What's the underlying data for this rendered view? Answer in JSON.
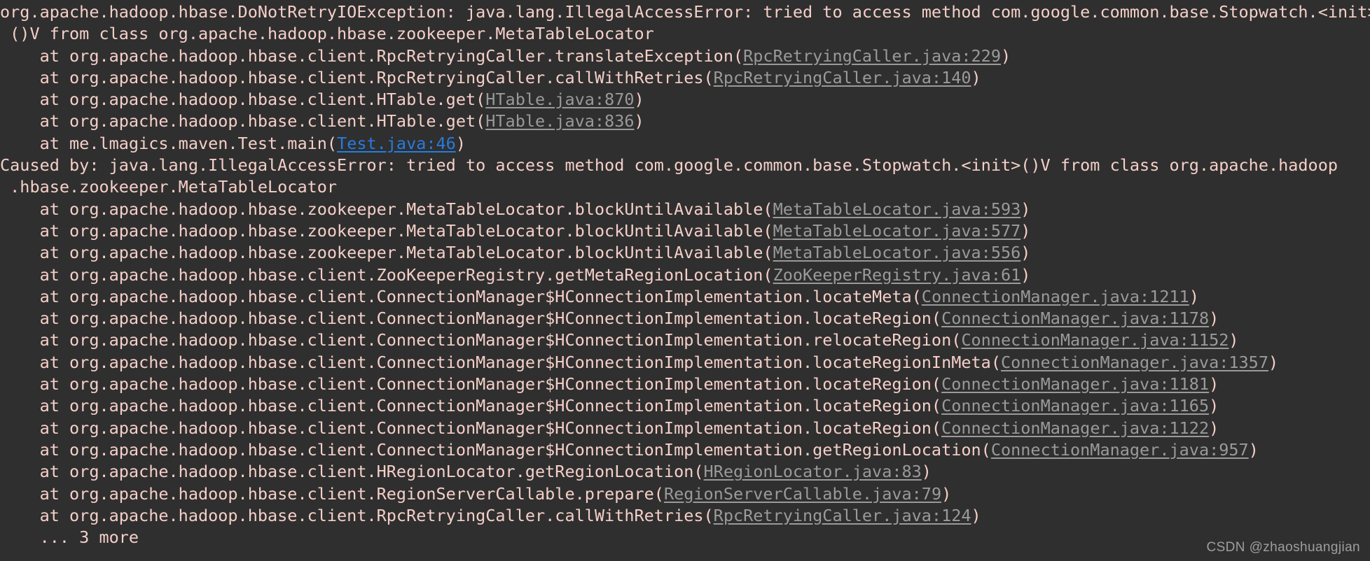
{
  "console": {
    "background_color": "#2f2f2f",
    "text_color": "#f5cfc8",
    "link_color": "#9a9a9a",
    "active_link_color": "#287bde",
    "watermark": "CSDN @zhaoshuangjian"
  },
  "stack_trace": {
    "lines": [
      {
        "id": "exception-header-1",
        "kind": "exception-header",
        "text": "org.apache.hadoop.hbase.DoNotRetryIOException: java.lang.IllegalAccessError: tried to access method com.google.common.base.Stopwatch.<init>"
      },
      {
        "id": "exception-header-2",
        "kind": "exception-header-cont",
        "text": " ()V from class org.apache.hadoop.hbase.zookeeper.MetaTableLocator"
      },
      {
        "id": "frame-1",
        "kind": "frame",
        "prefix": "    at org.apache.hadoop.hbase.client.RpcRetryingCaller.translateException(",
        "link": "RpcRetryingCaller.java:229",
        "link_state": "normal",
        "suffix": ")"
      },
      {
        "id": "frame-2",
        "kind": "frame",
        "prefix": "    at org.apache.hadoop.hbase.client.RpcRetryingCaller.callWithRetries(",
        "link": "RpcRetryingCaller.java:140",
        "link_state": "normal",
        "suffix": ")"
      },
      {
        "id": "frame-3",
        "kind": "frame",
        "prefix": "    at org.apache.hadoop.hbase.client.HTable.get(",
        "link": "HTable.java:870",
        "link_state": "normal",
        "suffix": ")"
      },
      {
        "id": "frame-4",
        "kind": "frame",
        "prefix": "    at org.apache.hadoop.hbase.client.HTable.get(",
        "link": "HTable.java:836",
        "link_state": "normal",
        "suffix": ")"
      },
      {
        "id": "frame-5",
        "kind": "frame",
        "prefix": "    at me.lmagics.maven.Test.main(",
        "link": "Test.java:46",
        "link_state": "active",
        "suffix": ")"
      },
      {
        "id": "caused-by-1",
        "kind": "caused-by",
        "text": "Caused by: java.lang.IllegalAccessError: tried to access method com.google.common.base.Stopwatch.<init>()V from class org.apache.hadoop"
      },
      {
        "id": "caused-by-2",
        "kind": "caused-by-cont",
        "text": " .hbase.zookeeper.MetaTableLocator"
      },
      {
        "id": "frame-6",
        "kind": "frame",
        "prefix": "    at org.apache.hadoop.hbase.zookeeper.MetaTableLocator.blockUntilAvailable(",
        "link": "MetaTableLocator.java:593",
        "link_state": "normal",
        "suffix": ")"
      },
      {
        "id": "frame-7",
        "kind": "frame",
        "prefix": "    at org.apache.hadoop.hbase.zookeeper.MetaTableLocator.blockUntilAvailable(",
        "link": "MetaTableLocator.java:577",
        "link_state": "normal",
        "suffix": ")"
      },
      {
        "id": "frame-8",
        "kind": "frame",
        "prefix": "    at org.apache.hadoop.hbase.zookeeper.MetaTableLocator.blockUntilAvailable(",
        "link": "MetaTableLocator.java:556",
        "link_state": "normal",
        "suffix": ")"
      },
      {
        "id": "frame-9",
        "kind": "frame",
        "prefix": "    at org.apache.hadoop.hbase.client.ZooKeeperRegistry.getMetaRegionLocation(",
        "link": "ZooKeeperRegistry.java:61",
        "link_state": "normal",
        "suffix": ")"
      },
      {
        "id": "frame-10",
        "kind": "frame",
        "prefix": "    at org.apache.hadoop.hbase.client.ConnectionManager$HConnectionImplementation.locateMeta(",
        "link": "ConnectionManager.java:1211",
        "link_state": "normal",
        "suffix": ")"
      },
      {
        "id": "frame-11",
        "kind": "frame",
        "prefix": "    at org.apache.hadoop.hbase.client.ConnectionManager$HConnectionImplementation.locateRegion(",
        "link": "ConnectionManager.java:1178",
        "link_state": "normal",
        "suffix": ")"
      },
      {
        "id": "frame-12",
        "kind": "frame",
        "prefix": "    at org.apache.hadoop.hbase.client.ConnectionManager$HConnectionImplementation.relocateRegion(",
        "link": "ConnectionManager.java:1152",
        "link_state": "normal",
        "suffix": ")"
      },
      {
        "id": "frame-13",
        "kind": "frame",
        "prefix": "    at org.apache.hadoop.hbase.client.ConnectionManager$HConnectionImplementation.locateRegionInMeta(",
        "link": "ConnectionManager.java:1357",
        "link_state": "normal",
        "suffix": ")"
      },
      {
        "id": "frame-14",
        "kind": "frame",
        "prefix": "    at org.apache.hadoop.hbase.client.ConnectionManager$HConnectionImplementation.locateRegion(",
        "link": "ConnectionManager.java:1181",
        "link_state": "normal",
        "suffix": ")"
      },
      {
        "id": "frame-15",
        "kind": "frame",
        "prefix": "    at org.apache.hadoop.hbase.client.ConnectionManager$HConnectionImplementation.locateRegion(",
        "link": "ConnectionManager.java:1165",
        "link_state": "normal",
        "suffix": ")"
      },
      {
        "id": "frame-16",
        "kind": "frame",
        "prefix": "    at org.apache.hadoop.hbase.client.ConnectionManager$HConnectionImplementation.locateRegion(",
        "link": "ConnectionManager.java:1122",
        "link_state": "normal",
        "suffix": ")"
      },
      {
        "id": "frame-17",
        "kind": "frame",
        "prefix": "    at org.apache.hadoop.hbase.client.ConnectionManager$HConnectionImplementation.getRegionLocation(",
        "link": "ConnectionManager.java:957",
        "link_state": "normal",
        "suffix": ")"
      },
      {
        "id": "frame-18",
        "kind": "frame",
        "prefix": "    at org.apache.hadoop.hbase.client.HRegionLocator.getRegionLocation(",
        "link": "HRegionLocator.java:83",
        "link_state": "normal",
        "suffix": ")"
      },
      {
        "id": "frame-19",
        "kind": "frame",
        "prefix": "    at org.apache.hadoop.hbase.client.RegionServerCallable.prepare(",
        "link": "RegionServerCallable.java:79",
        "link_state": "normal",
        "suffix": ")"
      },
      {
        "id": "frame-20",
        "kind": "frame",
        "prefix": "    at org.apache.hadoop.hbase.client.RpcRetryingCaller.callWithRetries(",
        "link": "RpcRetryingCaller.java:124",
        "link_state": "normal",
        "suffix": ")"
      },
      {
        "id": "more-frames",
        "kind": "more",
        "text": "    ... 3 more"
      }
    ]
  }
}
